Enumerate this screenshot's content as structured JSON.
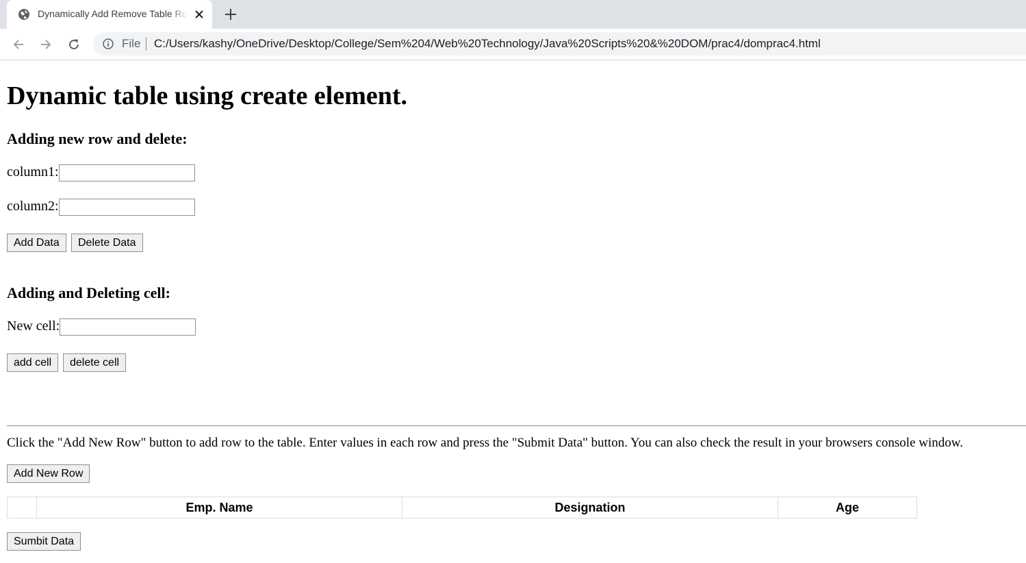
{
  "browser": {
    "tab_title": "Dynamically Add Remove Table Rows",
    "file_label": "File",
    "url": "C:/Users/kashy/OneDrive/Desktop/College/Sem%204/Web%20Technology/Java%20Scripts%20&%20DOM/prac4/domprac4.html",
    "icons": [
      "globe-icon",
      "close-icon",
      "plus-icon",
      "back-arrow-icon",
      "forward-arrow-icon",
      "reload-icon",
      "info-icon"
    ]
  },
  "page": {
    "title": "Dynamic table using create element.",
    "row_section": {
      "heading": "Adding new row and delete:",
      "column1_label": "column1:",
      "column1_value": "",
      "column2_label": "column2:",
      "column2_value": "",
      "add_button": "Add Data",
      "delete_button": "Delete Data"
    },
    "cell_section": {
      "heading": "Adding and Deleting cell:",
      "new_cell_label": "New cell:",
      "new_cell_value": "",
      "add_button": "add cell",
      "delete_button": "delete cell"
    },
    "instructions": "Click the \"Add New Row\" button to add row to the table. Enter values in each row and press the \"Submit Data\" button. You can also check the result in your browsers console window.",
    "add_row_button": "Add New Row",
    "table": {
      "headers": [
        "",
        "Emp. Name",
        "Designation",
        "Age"
      ]
    },
    "submit_button": "Sumbit Data"
  }
}
